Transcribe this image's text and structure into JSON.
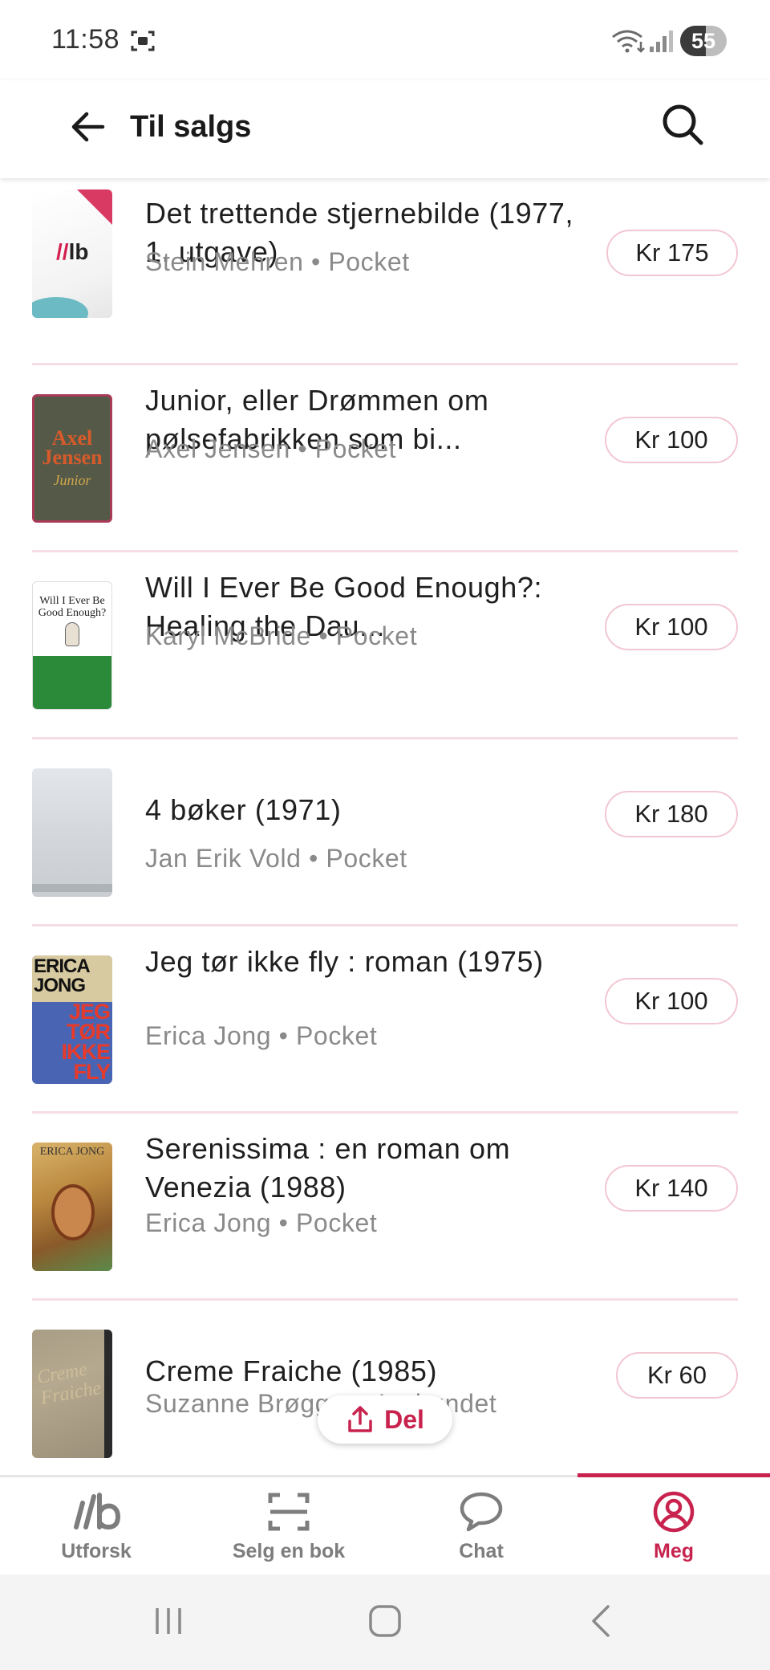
{
  "status_bar": {
    "time": "11:58",
    "battery": "55",
    "battery_level": 0.55
  },
  "app_bar": {
    "title": "Til salgs"
  },
  "books": [
    {
      "title": "Det trettende stjernebilde (1977, 1. utgave)",
      "author": "Stein Mehren",
      "format": "Pocket",
      "price": "Kr 175",
      "cover": {
        "kind": "logo",
        "text": "lb"
      }
    },
    {
      "title": "Junior, eller Drømmen om pølsefabrikken som bi...",
      "author": "Axel Jensen",
      "format": "Pocket",
      "price": "Kr 100",
      "cover": {
        "kind": "axel",
        "line1": "Axel",
        "line2": "Jensen",
        "line3": "Junior"
      }
    },
    {
      "title": "Will I Ever Be Good Enough?: Healing the Dau...",
      "author": "Karyl McBride",
      "format": "Pocket",
      "price": "Kr 100",
      "cover": {
        "kind": "will",
        "text": "Will I Ever Be Good Enough?"
      }
    },
    {
      "title": "4 bøker (1971)",
      "author": "Jan Erik Vold",
      "format": "Pocket",
      "price": "Kr 180",
      "cover": {
        "kind": "plain"
      }
    },
    {
      "title": "Jeg tør ikke fly : roman (1975)",
      "author": "Erica Jong",
      "format": "Pocket",
      "price": "Kr 100",
      "cover": {
        "kind": "jong",
        "line1": "ERICA",
        "line2": "JONG",
        "line3": "JEG",
        "line4": "TØR",
        "line5": "IKKE",
        "line6": "FLY"
      }
    },
    {
      "title": "Serenissima : en roman om Venezia (1988)",
      "author": "Erica Jong",
      "format": "Pocket",
      "price": "Kr 140",
      "cover": {
        "kind": "seren",
        "text": "ERICA JONG"
      }
    },
    {
      "title": "Creme Fraiche (1985)",
      "author": "Suzanne Brøgger",
      "format": "Innbundet",
      "price": "Kr 60",
      "cover": {
        "kind": "creme",
        "text": "Creme Fraiche"
      }
    }
  ],
  "share_button": {
    "label": "Del"
  },
  "bottom_nav": [
    {
      "label": "Utforsk",
      "icon": "lb-logo-icon",
      "active": false
    },
    {
      "label": "Selg en bok",
      "icon": "scan-icon",
      "active": false
    },
    {
      "label": "Chat",
      "icon": "chat-bubble-icon",
      "active": false
    },
    {
      "label": "Meg",
      "icon": "profile-icon",
      "active": true
    }
  ],
  "colors": {
    "accent": "#c8234e",
    "divider": "#f6dde3",
    "price_border": "#f2c7d2",
    "muted_text": "#8a8a8a"
  }
}
